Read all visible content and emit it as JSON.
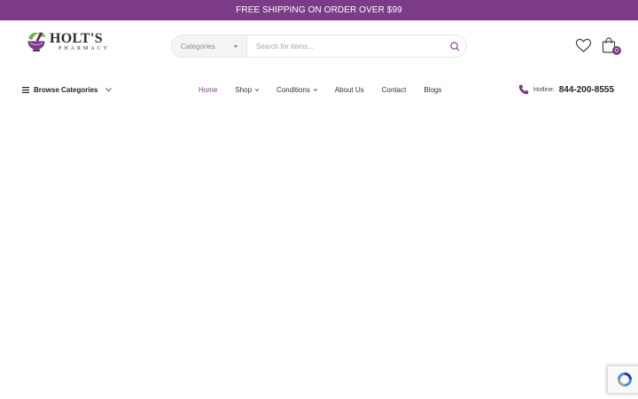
{
  "announcement": {
    "text": "FREE SHIPPING ON ORDER OVER $99"
  },
  "brand": {
    "name": "HOLT'S",
    "subtitle": "PHARMACY"
  },
  "search": {
    "category": "Categories",
    "placeholder": "Search for items..."
  },
  "cart": {
    "count": "0"
  },
  "browse": {
    "label": "Browse Categories"
  },
  "nav": {
    "items": [
      {
        "label": "Home",
        "active": true,
        "dropdown": false
      },
      {
        "label": "Shop",
        "active": false,
        "dropdown": true
      },
      {
        "label": "Conditions",
        "active": false,
        "dropdown": true
      },
      {
        "label": "About Us",
        "active": false,
        "dropdown": false
      },
      {
        "label": "Contact",
        "active": false,
        "dropdown": false
      },
      {
        "label": "Blogs",
        "active": false,
        "dropdown": false
      }
    ]
  },
  "hotline": {
    "label": "Hotline:",
    "number": "844-200-8555"
  },
  "colors": {
    "brand": "#7b3b86",
    "text": "#222222"
  }
}
